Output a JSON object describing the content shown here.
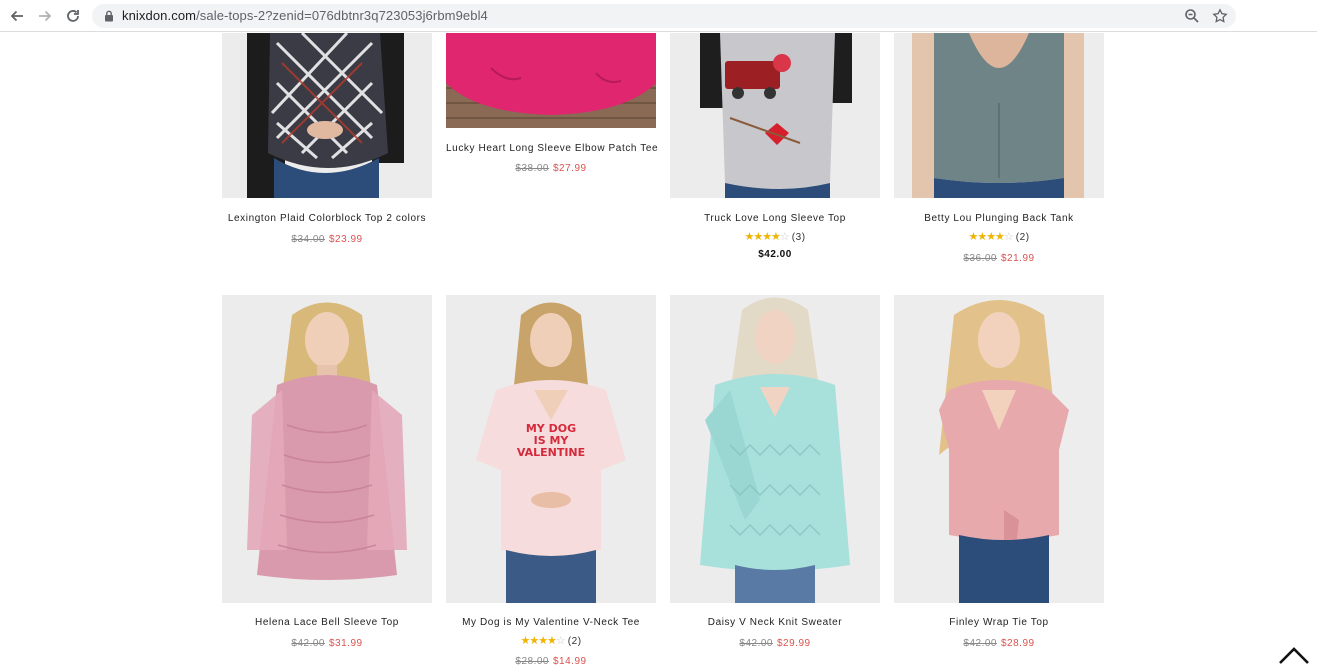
{
  "browser": {
    "url_domain": "knixdon.com",
    "url_path": "/sale-tops-2?zenid=076dbtnr3q723053j6rbm9ebl4"
  },
  "colors": {
    "sale_price": "#d9534f",
    "star": "#f0b400"
  },
  "products": [
    {
      "name": "Lexington Plaid Colorblock Top 2 colors",
      "old_price": "$34.00",
      "sale_price": "$23.99",
      "rating": null
    },
    {
      "name": "Lucky Heart Long Sleeve Elbow Patch Tee",
      "old_price": "$38.00",
      "sale_price": "$27.99",
      "rating": null
    },
    {
      "name": "Truck Love Long Sleeve Top",
      "price": "$42.00",
      "rating": 4,
      "rating_count": "(3)"
    },
    {
      "name": "Betty Lou Plunging Back Tank",
      "old_price": "$36.00",
      "sale_price": "$21.99",
      "rating": 4,
      "rating_count": "(2)"
    },
    {
      "name": "Helena Lace Bell Sleeve Top",
      "old_price": "$42.00",
      "sale_price": "$31.99",
      "rating": null
    },
    {
      "name": "My Dog is My Valentine V-Neck Tee",
      "old_price": "$28.00",
      "sale_price": "$14.99",
      "rating": 4,
      "rating_count": "(2)",
      "shirt_text": [
        "MY DOG",
        "IS MY",
        "VALENTINE"
      ]
    },
    {
      "name": "Daisy V Neck Knit Sweater",
      "old_price": "$42.00",
      "sale_price": "$29.99",
      "rating": null
    },
    {
      "name": "Finley Wrap Tie Top",
      "old_price": "$42.00",
      "sale_price": "$28.99",
      "rating": null
    }
  ]
}
